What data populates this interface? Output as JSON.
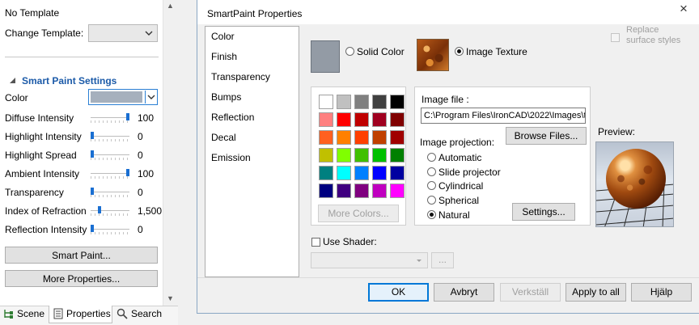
{
  "left_panel": {
    "template_label": "No Template",
    "change_template_label": "Change Template:",
    "section_title": "Smart Paint Settings",
    "color_label": "Color",
    "color_value": "#a6b0bd",
    "properties": [
      {
        "label": "Diffuse Intensity",
        "value": "100",
        "level": 1.0
      },
      {
        "label": "Highlight Intensity",
        "value": "0",
        "level": 0.0
      },
      {
        "label": "Highlight Spread",
        "value": "0",
        "level": 0.0
      },
      {
        "label": "Ambient Intensity",
        "value": "100",
        "level": 1.0
      },
      {
        "label": "Transparency",
        "value": "0",
        "level": 0.0
      },
      {
        "label": "Index of Refraction",
        "value": "1,500",
        "level": 0.2
      },
      {
        "label": "Reflection Intensity",
        "value": "0",
        "level": 0.0
      }
    ],
    "smart_paint_button": "Smart Paint...",
    "more_properties_button": "More Properties...",
    "bottom_tabs": {
      "scene": "Scene",
      "properties": "Properties",
      "search": "Search"
    }
  },
  "dialog": {
    "title": "SmartPaint Properties",
    "close_glyph": "×",
    "tabs": [
      "Color",
      "Finish",
      "Transparency",
      "Bumps",
      "Reflection",
      "Decal",
      "Emission"
    ],
    "solid_color_label": "Solid Color",
    "image_texture_label": "Image Texture",
    "replace_surface_styles_label": "Replace surface styles",
    "palette_colors": [
      "#ffffff",
      "#c0c0c0",
      "#808080",
      "#404040",
      "#000000",
      "#ff8080",
      "#ff0000",
      "#c00000",
      "#a00020",
      "#800000",
      "#ff6020",
      "#ff8000",
      "#ff4000",
      "#c04000",
      "#a00000",
      "#c0c000",
      "#80ff00",
      "#40c000",
      "#00c000",
      "#008000",
      "#008080",
      "#00ffff",
      "#0080ff",
      "#0000ff",
      "#0000a0",
      "#000080",
      "#400080",
      "#800080",
      "#c000c0",
      "#ff00ff"
    ],
    "more_colors_button": "More Colors...",
    "image_file_label": "Image file :",
    "image_file_value": "C:\\Program Files\\IronCAD\\2022\\Images\\t",
    "browse_files_button": "Browse Files...",
    "image_projection_label": "Image projection:",
    "projections": [
      "Automatic",
      "Slide projector",
      "Cylindrical",
      "Spherical",
      "Natural"
    ],
    "selected_projection": "Natural",
    "settings_button": "Settings...",
    "preview_label": "Preview:",
    "use_shader_label": "Use Shader:",
    "shader_browse_button": "...",
    "footer": {
      "ok": "OK",
      "cancel": "Avbryt",
      "apply": "Verkställ",
      "apply_all": "Apply to all",
      "help": "Hjälp"
    }
  }
}
